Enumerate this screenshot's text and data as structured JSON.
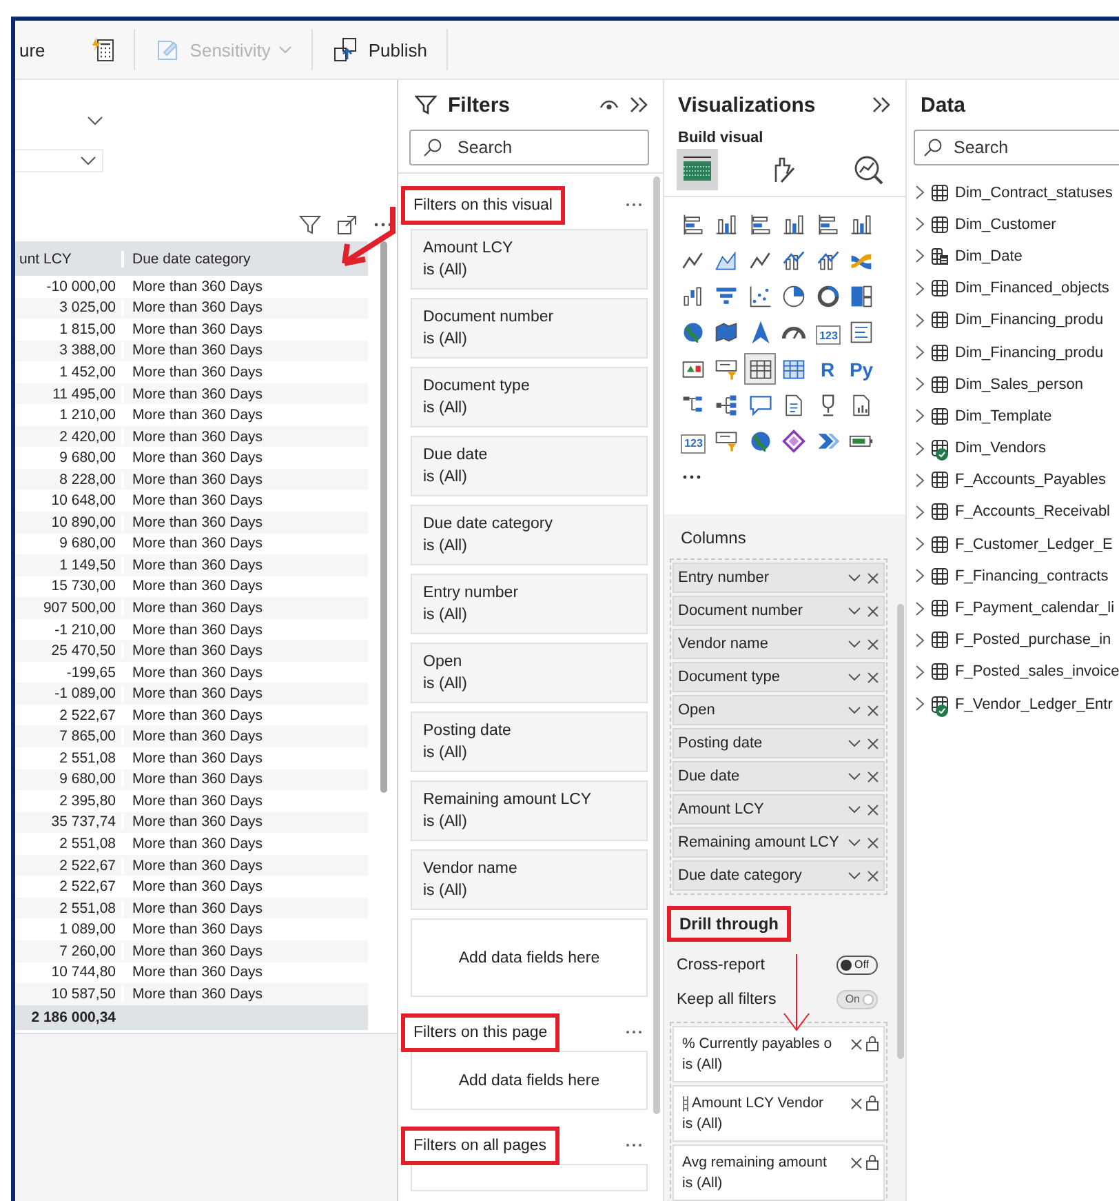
{
  "toolbar": [
    {
      "kind": "text",
      "label": "ure"
    },
    {
      "kind": "icon"
    },
    {
      "kind": "dropdown",
      "label": "Sensitivity",
      "disabled": true
    },
    {
      "kind": "button",
      "label": "Publish",
      "disabled": false
    }
  ],
  "canvas": {
    "table": {
      "columns": [
        "unt LCY",
        "Due date category"
      ],
      "rows": [
        [
          "-10 000,00",
          "More than 360 Days"
        ],
        [
          "3 025,00",
          "More than 360 Days"
        ],
        [
          "1 815,00",
          "More than 360 Days"
        ],
        [
          "3 388,00",
          "More than 360 Days"
        ],
        [
          "1 452,00",
          "More than 360 Days"
        ],
        [
          "11 495,00",
          "More than 360 Days"
        ],
        [
          "1 210,00",
          "More than 360 Days"
        ],
        [
          "2 420,00",
          "More than 360 Days"
        ],
        [
          "9 680,00",
          "More than 360 Days"
        ],
        [
          "8 228,00",
          "More than 360 Days"
        ],
        [
          "10 648,00",
          "More than 360 Days"
        ],
        [
          "10 890,00",
          "More than 360 Days"
        ],
        [
          "9 680,00",
          "More than 360 Days"
        ],
        [
          "1 149,50",
          "More than 360 Days"
        ],
        [
          "15 730,00",
          "More than 360 Days"
        ],
        [
          "907 500,00",
          "More than 360 Days"
        ],
        [
          "-1 210,00",
          "More than 360 Days"
        ],
        [
          "25 470,50",
          "More than 360 Days"
        ],
        [
          "-199,65",
          "More than 360 Days"
        ],
        [
          "-1 089,00",
          "More than 360 Days"
        ],
        [
          "2 522,67",
          "More than 360 Days"
        ],
        [
          "7 865,00",
          "More than 360 Days"
        ],
        [
          "2 551,08",
          "More than 360 Days"
        ],
        [
          "9 680,00",
          "More than 360 Days"
        ],
        [
          "2 395,80",
          "More than 360 Days"
        ],
        [
          "35 737,74",
          "More than 360 Days"
        ],
        [
          "2 551,08",
          "More than 360 Days"
        ],
        [
          "2 522,67",
          "More than 360 Days"
        ],
        [
          "2 522,67",
          "More than 360 Days"
        ],
        [
          "2 551,08",
          "More than 360 Days"
        ],
        [
          "1 089,00",
          "More than 360 Days"
        ],
        [
          "7 260,00",
          "More than 360 Days"
        ],
        [
          "10 744,80",
          "More than 360 Days"
        ],
        [
          "10 587,50",
          "More than 360 Days"
        ]
      ],
      "total": "2 186 000,34"
    }
  },
  "filters": {
    "title": "Filters",
    "search": {
      "placeholder": "Search"
    },
    "sections": [
      {
        "title": "Filters on this visual",
        "highlighted": true,
        "cards": [
          {
            "field": "Amount LCY",
            "condition": "is (All)"
          },
          {
            "field": "Document number",
            "condition": "is (All)"
          },
          {
            "field": "Document type",
            "condition": "is (All)"
          },
          {
            "field": "Due date",
            "condition": "is (All)"
          },
          {
            "field": "Due date category",
            "condition": "is (All)"
          },
          {
            "field": "Entry number",
            "condition": "is (All)"
          },
          {
            "field": "Open",
            "condition": "is (All)"
          },
          {
            "field": "Posting date",
            "condition": "is (All)"
          },
          {
            "field": "Remaining amount LCY",
            "condition": "is (All)"
          },
          {
            "field": "Vendor name",
            "condition": "is (All)"
          }
        ],
        "add_label": "Add data fields here"
      },
      {
        "title": "Filters on this page",
        "highlighted": true,
        "add_label": "Add data fields here"
      },
      {
        "title": "Filters on all pages",
        "highlighted": true
      }
    ]
  },
  "visualizations": {
    "title": "Visualizations",
    "build_label": "Build visual",
    "build_tabs": [
      {
        "selected": true
      },
      {
        "selected": false
      },
      {
        "selected": false
      }
    ],
    "visual_types": [
      {
        "selected": false
      },
      {
        "selected": false
      },
      {
        "selected": false
      },
      {
        "selected": false
      },
      {
        "selected": false
      },
      {
        "selected": false
      },
      {
        "selected": false
      },
      {
        "selected": false
      },
      {
        "selected": false
      },
      {
        "selected": false
      },
      {
        "selected": false
      },
      {
        "selected": false
      },
      {
        "selected": false
      },
      {
        "selected": false
      },
      {
        "selected": false
      },
      {
        "selected": false
      },
      {
        "selected": false
      },
      {
        "selected": false
      },
      {
        "selected": false
      },
      {
        "selected": false
      },
      {
        "selected": false
      },
      {
        "selected": false
      },
      {
        "selected": false,
        "glyph": "123"
      },
      {
        "selected": false
      },
      {
        "selected": false
      },
      {
        "selected": false
      },
      {
        "selected": true
      },
      {
        "selected": false
      },
      {
        "selected": false,
        "glyph": "R"
      },
      {
        "selected": false,
        "glyph": "Py"
      },
      {
        "selected": false
      },
      {
        "selected": false
      },
      {
        "selected": false
      },
      {
        "selected": false
      },
      {
        "selected": false
      },
      {
        "selected": false
      },
      {
        "selected": false,
        "glyph": "123"
      },
      {
        "selected": false
      },
      {
        "selected": false
      },
      {
        "selected": false
      },
      {
        "selected": false
      },
      {
        "selected": false
      }
    ],
    "wells": {
      "label": "Columns",
      "fields": [
        "Entry number",
        "Document number",
        "Vendor name",
        "Document type",
        "Open",
        "Posting date",
        "Due date",
        "Amount LCY",
        "Remaining amount LCY",
        "Due date category"
      ]
    },
    "drill": {
      "title": "Drill through",
      "highlighted": true,
      "toggles": [
        {
          "label": "Cross-report",
          "on": false,
          "disabled": false,
          "state_text": "Off"
        },
        {
          "label": "Keep all filters",
          "on": true,
          "disabled": true,
          "state_text": "On"
        }
      ],
      "cards": [
        {
          "field": "% Currently payables o",
          "condition": "is (All)",
          "kind": "measure"
        },
        {
          "field": "Amount LCY Vendor",
          "condition": "is (All)",
          "kind": "column"
        },
        {
          "field": "Avg remaining amount",
          "condition": "is (All)",
          "kind": "measure"
        }
      ]
    }
  },
  "data": {
    "title": "Data",
    "search": {
      "placeholder": "Search"
    },
    "tables": [
      {
        "name": "Dim_Contract_statuses",
        "kind": "table",
        "linked": false
      },
      {
        "name": "Dim_Customer",
        "kind": "table",
        "linked": false
      },
      {
        "name": "Dim_Date",
        "kind": "date",
        "linked": false
      },
      {
        "name": "Dim_Financed_objects",
        "kind": "table",
        "linked": false
      },
      {
        "name": "Dim_Financing_produ",
        "kind": "table",
        "linked": false
      },
      {
        "name": "Dim_Financing_produ",
        "kind": "table",
        "linked": false
      },
      {
        "name": "Dim_Sales_person",
        "kind": "table",
        "linked": false
      },
      {
        "name": "Dim_Template",
        "kind": "table",
        "linked": false
      },
      {
        "name": "Dim_Vendors",
        "kind": "table",
        "linked": true
      },
      {
        "name": "F_Accounts_Payables",
        "kind": "table",
        "linked": false
      },
      {
        "name": "F_Accounts_Receivabl",
        "kind": "table",
        "linked": false
      },
      {
        "name": "F_Customer_Ledger_E",
        "kind": "table",
        "linked": false
      },
      {
        "name": "F_Financing_contracts",
        "kind": "table",
        "linked": false
      },
      {
        "name": "F_Payment_calendar_li",
        "kind": "table",
        "linked": false
      },
      {
        "name": "F_Posted_purchase_in",
        "kind": "table",
        "linked": false
      },
      {
        "name": "F_Posted_sales_invoice",
        "kind": "table",
        "linked": false
      },
      {
        "name": "F_Vendor_Ledger_Entr",
        "kind": "table",
        "linked": true
      }
    ]
  }
}
